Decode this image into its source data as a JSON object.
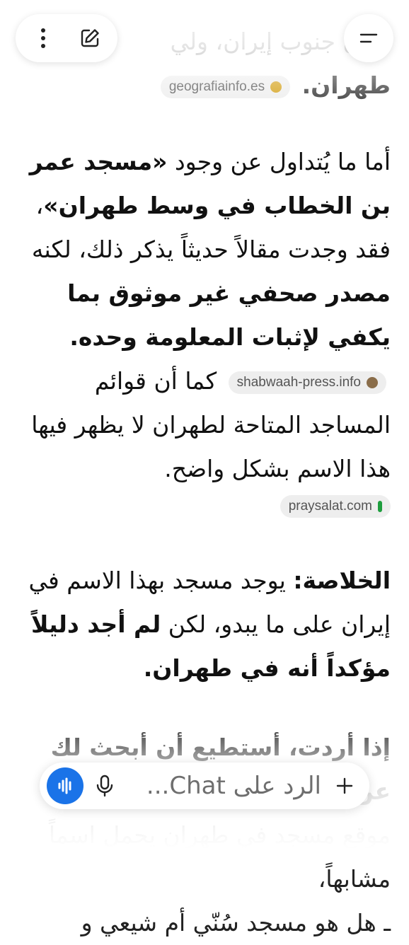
{
  "chat": {
    "top_partial": {
      "line1_text": "وغان جنوب إيران، ولي",
      "line2_text": "طهران.",
      "cite": {
        "label": "geografiainfo.es",
        "favicon_color": "#d4a017"
      }
    },
    "para1": {
      "seg1": "أما ما يُتداول عن وجود ",
      "seg2_bold": "«مسجد عمر بن الخطاب في وسط طهران»",
      "seg3": "، فقد وجدت مقالاً حديثاً يذكر ذلك، لكنه ",
      "seg4_bold": "مصدر صحفي غير موثوق بما يكفي لإثبات المعلومة وحده.",
      "cite1": {
        "label": "shabwaah-press.info",
        "favicon_color": "#8a6d4a"
      },
      "seg5": " كما أن قوائم المساجد المتاحة لطهران لا يظهر فيها هذا الاسم بشكل واضح.",
      "cite2": {
        "label": "praysalat.com",
        "favicon_color": "#1e9e3e"
      }
    },
    "para2": {
      "seg1_bold": "الخلاصة:",
      "seg2": " يوجد مسجد بهذا الاسم في إيران على ما يبدو، لكن ",
      "seg3_bold": "لم أجد دليلاً مؤكداً أنه في طهران."
    },
    "bottom_partial": {
      "line1": "إذا أردت، أستطيع أن أبحث لك عن",
      "line2": "موقع مسجد في طهران يحمل اسماً مشابهاً،",
      "line3": "ـ هل هو مسجد سُنّي أم شيعي و"
    }
  },
  "top_bar": {
    "more_icon": "more-vertical-icon",
    "edit_icon": "edit-pen-icon",
    "menu_icon": "menu-icon"
  },
  "input_bar": {
    "placeholder": "الرد على Chat...",
    "mic_icon": "microphone-icon",
    "voice_icon": "voice-waveform-icon",
    "add_icon": "plus-icon",
    "accent": "#1a73e8"
  }
}
